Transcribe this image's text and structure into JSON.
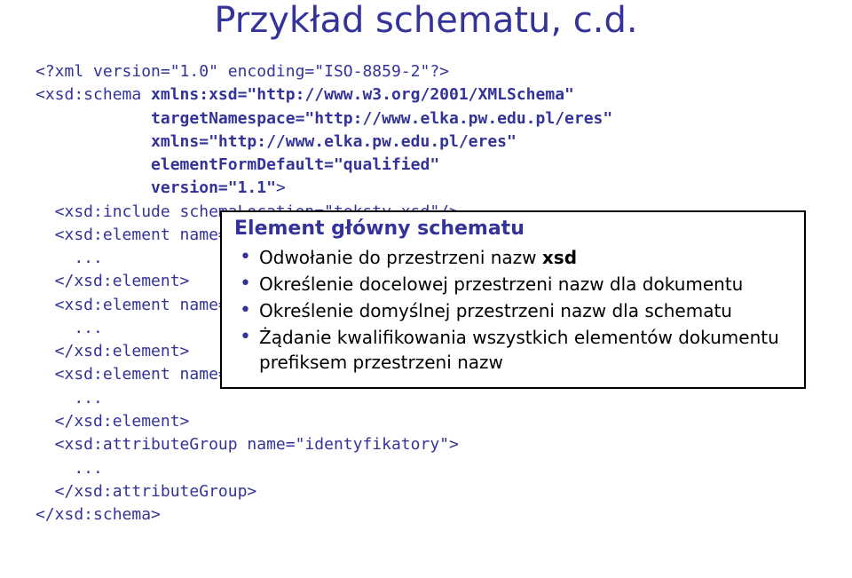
{
  "title": "Przykład schematu, c.d.",
  "code": {
    "l0": "<?xml version=\"1.0\" encoding=\"ISO-8859-2\"?>",
    "l1a": "<xsd:schema ",
    "l1b": "xmlns:xsd=\"http://www.w3.org/2001/XMLSchema\"",
    "l2": "            targetNamespace=\"http://www.elka.pw.edu.pl/eres\"",
    "l3": "            xmlns=\"http://www.elka.pw.edu.pl/eres\"",
    "l4": "            elementFormDefault=\"qualified\"",
    "l5a": "            version=\"1.1\"",
    "l5b": ">",
    "l6": "  <xsd:include schemaLocation=\"teksty.xsd\"/>",
    "l7": "  <xsd:element name=\"eres\">",
    "l8": "    ...",
    "l9": "  </xsd:element>",
    "l10": "  <xsd:element name=\"osoba\">",
    "l11": "    ...",
    "l12": "  </xsd:element>",
    "l13": "  <xsd:element name=\"przedmiot\">",
    "l14": "    ...",
    "l15": "  </xsd:element>",
    "l16": "  <xsd:attributeGroup name=\"identyfikatory\">",
    "l17": "    ...",
    "l18": "  </xsd:attributeGroup>",
    "l19": "</xsd:schema>"
  },
  "popup": {
    "title": "Element główny schematu",
    "items": [
      {
        "prefix": "Odwołanie do przestrzeni nazw ",
        "kw": "xsd",
        "suffix": ""
      },
      {
        "prefix": "Określenie docelowej przestrzeni nazw dla dokumentu",
        "kw": "",
        "suffix": ""
      },
      {
        "prefix": "Określenie domyślnej przestrzeni nazw dla schematu",
        "kw": "",
        "suffix": ""
      },
      {
        "prefix": "Żądanie kwalifikowania wszystkich elementów dokumentu prefiksem przestrzeni nazw",
        "kw": "",
        "suffix": ""
      }
    ]
  }
}
